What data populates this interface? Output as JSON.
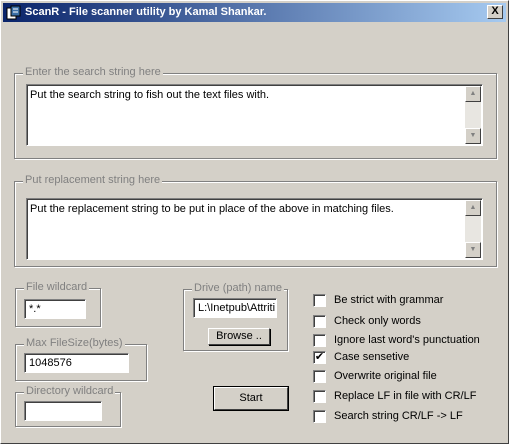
{
  "window": {
    "title": "ScanR - File scanner utility by Kamal Shankar.",
    "close_glyph": "X"
  },
  "search": {
    "legend": "Enter the search string here",
    "value": "Put the search string to fish out the text files with."
  },
  "replace": {
    "legend": "Put replacement string here",
    "value": "Put the replacement string to be put in place of the above in matching files."
  },
  "file_wildcard": {
    "legend": "File wildcard",
    "value": "*.*"
  },
  "max_filesize": {
    "legend": "Max FileSize(bytes)",
    "value": "1048576"
  },
  "dir_wildcard": {
    "legend": "Directory wildcard",
    "value": ""
  },
  "drive": {
    "legend": "Drive (path) name",
    "value": "L:\\Inetpub\\Attriti",
    "browse_label": "Browse .."
  },
  "start_label": "Start",
  "options": [
    {
      "label": "Be strict with grammar",
      "checked": false
    },
    {
      "label": "Check only words",
      "checked": false
    },
    {
      "label": "Ignore last word's punctuation",
      "checked": false
    },
    {
      "label": "Case sensetive",
      "checked": true
    },
    {
      "label": "Overwrite original file",
      "checked": false
    },
    {
      "label": "Replace LF in file with CR/LF",
      "checked": false
    },
    {
      "label": "Search string CR/LF -> LF",
      "checked": false
    }
  ],
  "check_glyph": "✔"
}
